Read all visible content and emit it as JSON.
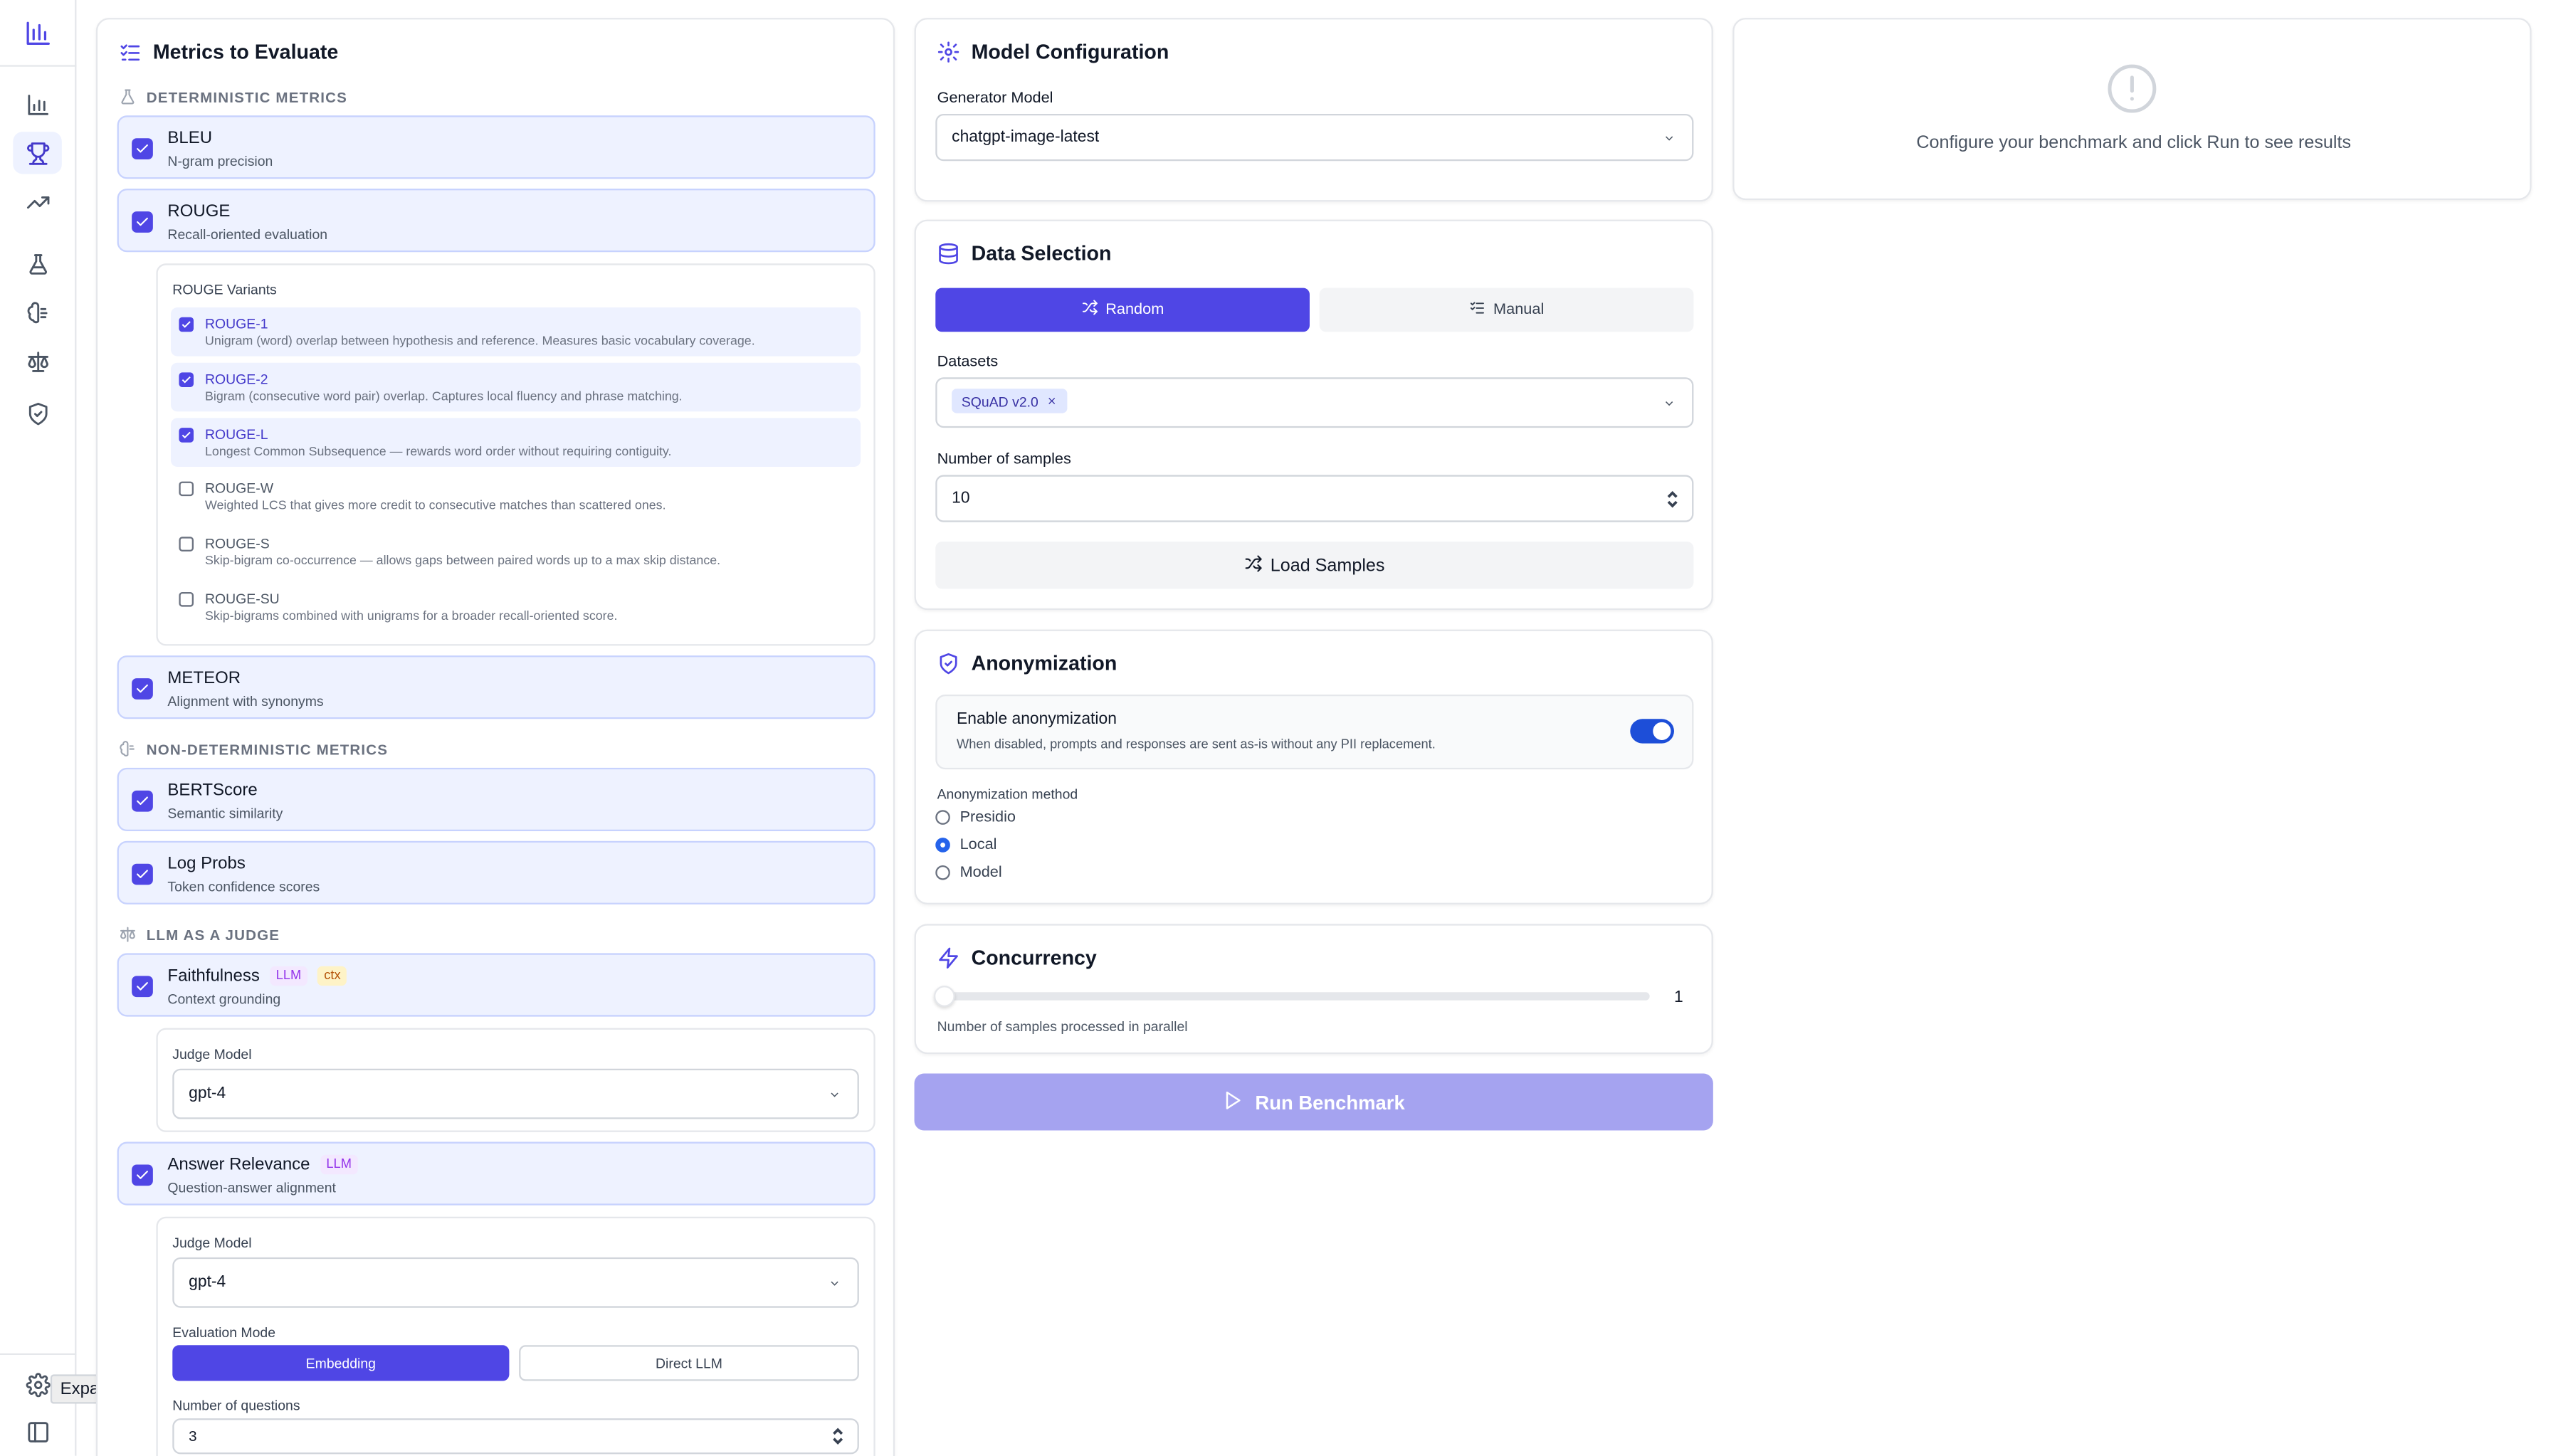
{
  "sidebar": {
    "tooltip": "Expand sidebar",
    "icons": [
      "bar-chart-logo-icon",
      "bar-chart-icon",
      "trophy-icon",
      "trending-up-icon",
      "flask-icon",
      "brain-icon",
      "scale-icon",
      "shield-check-icon",
      "gear-icon",
      "panel-left-icon"
    ],
    "active": "trophy-icon"
  },
  "metrics_panel": {
    "title": "Metrics to Evaluate",
    "deterministic_label": "DETERMINISTIC METRICS",
    "nondeterministic_label": "NON-DETERMINISTIC METRICS",
    "llm_judge_label": "LLM AS A JUDGE",
    "bleu": {
      "name": "BLEU",
      "desc": "N-gram precision",
      "checked": true
    },
    "rouge": {
      "name": "ROUGE",
      "desc": "Recall-oriented evaluation",
      "checked": true
    },
    "rouge_variants_title": "ROUGE Variants",
    "rouge_variants": [
      {
        "name": "ROUGE-1",
        "desc": "Unigram (word) overlap between hypothesis and reference. Measures basic vocabulary coverage.",
        "checked": true
      },
      {
        "name": "ROUGE-2",
        "desc": "Bigram (consecutive word pair) overlap. Captures local fluency and phrase matching.",
        "checked": true
      },
      {
        "name": "ROUGE-L",
        "desc": "Longest Common Subsequence — rewards word order without requiring contiguity.",
        "checked": true
      },
      {
        "name": "ROUGE-W",
        "desc": "Weighted LCS that gives more credit to consecutive matches than scattered ones.",
        "checked": false
      },
      {
        "name": "ROUGE-S",
        "desc": "Skip-bigram co-occurrence — allows gaps between paired words up to a max skip distance.",
        "checked": false
      },
      {
        "name": "ROUGE-SU",
        "desc": "Skip-bigrams combined with unigrams for a broader recall-oriented score.",
        "checked": false
      }
    ],
    "meteor": {
      "name": "METEOR",
      "desc": "Alignment with synonyms",
      "checked": true
    },
    "bertscore": {
      "name": "BERTScore",
      "desc": "Semantic similarity",
      "checked": true
    },
    "logprobs": {
      "name": "Log Probs",
      "desc": "Token confidence scores",
      "checked": true
    },
    "faithfulness": {
      "name": "Faithfulness",
      "desc": "Context grounding",
      "badges": [
        "LLM",
        "ctx"
      ],
      "checked": true,
      "judge_label": "Judge Model",
      "judge_value": "gpt-4"
    },
    "answer_relevance": {
      "name": "Answer Relevance",
      "desc": "Question-answer alignment",
      "badges": [
        "LLM"
      ],
      "checked": true,
      "judge_label": "Judge Model",
      "judge_value": "gpt-4",
      "mode_label": "Evaluation Mode",
      "mode_options": [
        "Embedding",
        "Direct LLM"
      ],
      "mode_selected": "Embedding",
      "questions_label": "Number of questions",
      "questions_value": "3"
    }
  },
  "model_config": {
    "title": "Model Configuration",
    "generator_label": "Generator Model",
    "generator_value": "chatgpt-image-latest"
  },
  "data_selection": {
    "title": "Data Selection",
    "modes": [
      "Random",
      "Manual"
    ],
    "mode_selected": "Random",
    "datasets_label": "Datasets",
    "datasets": [
      "SQuAD v2.0"
    ],
    "samples_label": "Number of samples",
    "samples_value": "10",
    "load_button": "Load Samples"
  },
  "anonymization": {
    "title": "Anonymization",
    "enable_label": "Enable anonymization",
    "enable_desc": "When disabled, prompts and responses are sent as-is without any PII replacement.",
    "enabled": true,
    "method_label": "Anonymization method",
    "methods": [
      "Presidio",
      "Local",
      "Model"
    ],
    "method_selected": "Local"
  },
  "concurrency": {
    "title": "Concurrency",
    "value": "1",
    "desc": "Number of samples processed in parallel"
  },
  "run_button": "Run Benchmark",
  "results": {
    "empty_message": "Configure your benchmark and click Run to see results"
  },
  "colors": {
    "accent": "#4f46e5",
    "accent_light": "#eef2ff",
    "run_button_disabled": "#a5a3f0"
  }
}
